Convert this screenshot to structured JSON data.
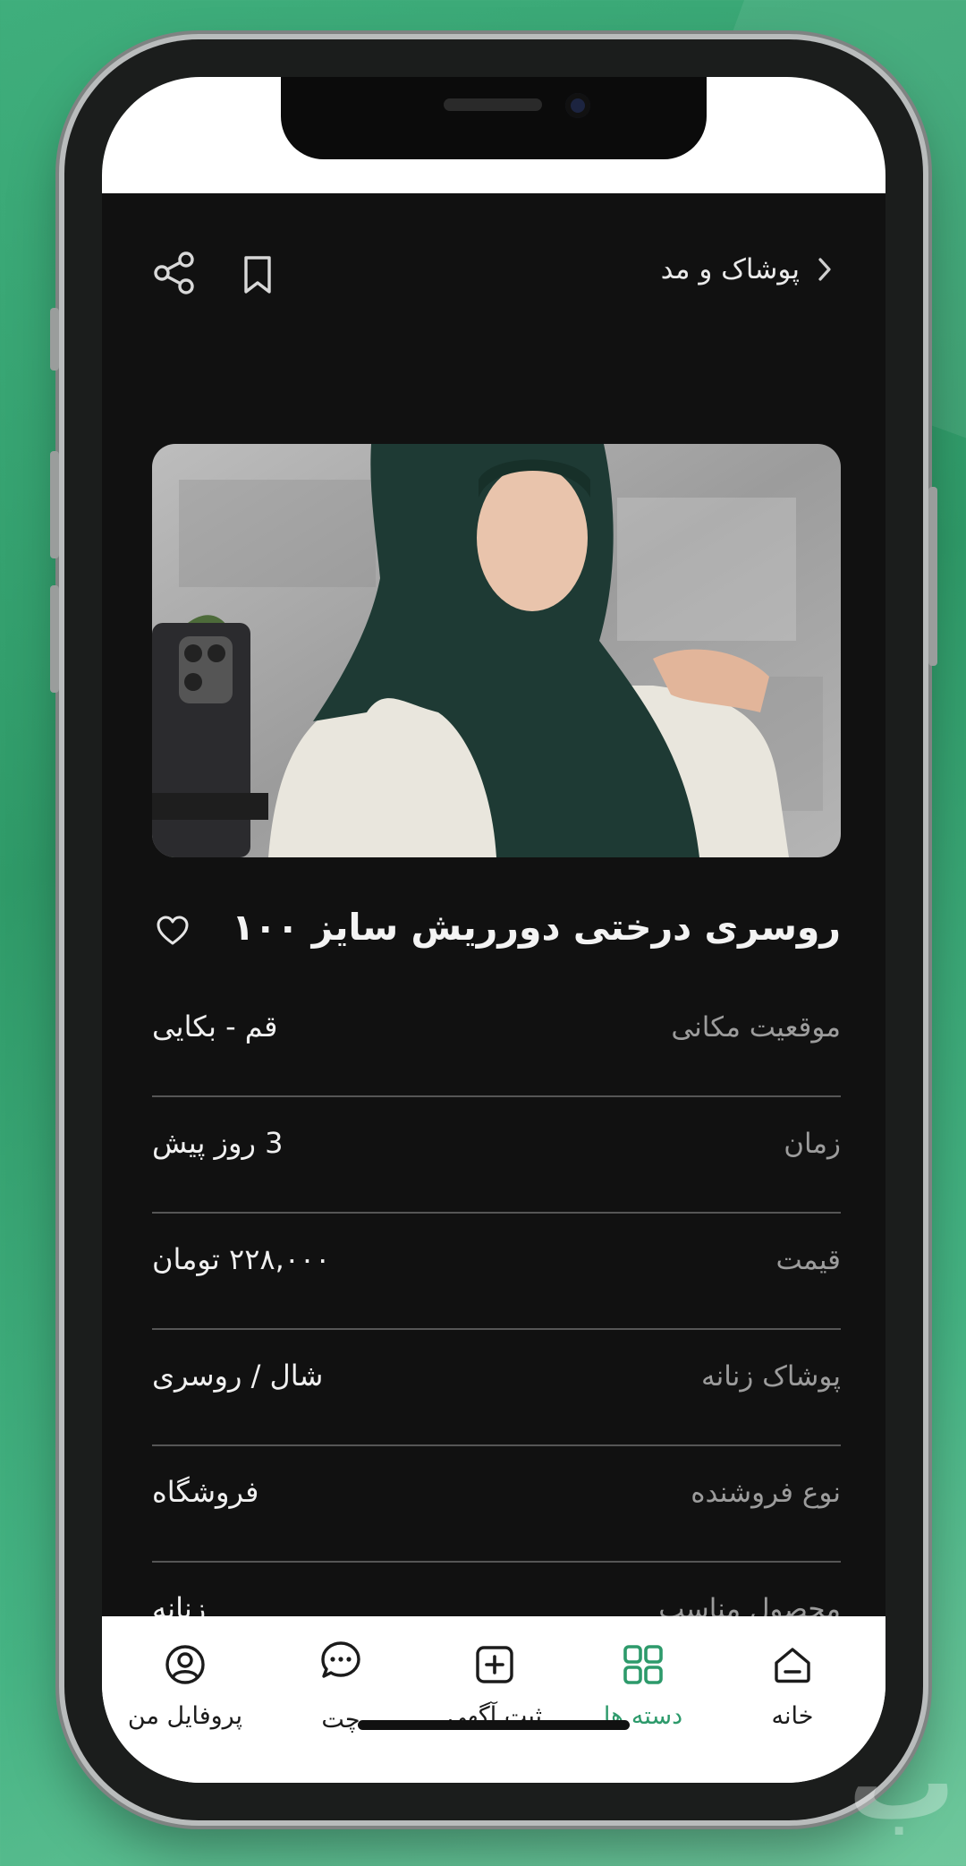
{
  "header": {
    "category": "پوشاک و مد"
  },
  "product": {
    "title": "روسری درختی دورریش سایز ۱۰۰"
  },
  "details": [
    {
      "label": "موقعیت مکانی",
      "value": "قم - بکایی"
    },
    {
      "label": "زمان",
      "value": "3 روز پیش"
    },
    {
      "label": "قیمت",
      "value": "۲۲۸,۰۰۰ تومان"
    },
    {
      "label": "پوشاک زنانه",
      "value": "شال / روسری"
    },
    {
      "label": "نوع فروشنده",
      "value": "فروشگاه"
    },
    {
      "label": "محصول مناسب",
      "value": "زنانه"
    }
  ],
  "nav": {
    "home": "خانه",
    "categories": "دسته ها",
    "post_ad": "ثبت آگهی",
    "chat": "چت",
    "profile": "پروفایل من",
    "active": "categories"
  },
  "colors": {
    "accent": "#2d9a6b",
    "background": "#111111",
    "divider": "#565656"
  },
  "icons": [
    "chevron-right-icon",
    "bookmark-icon",
    "share-icon",
    "heart-icon",
    "home-icon",
    "grid-icon",
    "plus-square-icon",
    "chat-bubble-icon",
    "profile-icon"
  ]
}
